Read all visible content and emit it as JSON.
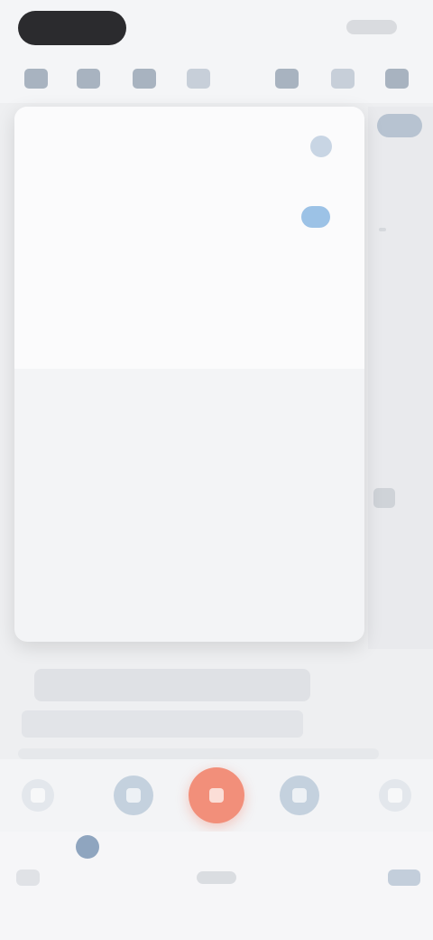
{
  "status_bar": {
    "time": "",
    "indicators": ""
  },
  "toolbar": {
    "tools": [
      {
        "icon": "grid-icon"
      },
      {
        "icon": "bookmark-icon"
      },
      {
        "icon": "tag-icon"
      },
      {
        "icon": "layout-icon"
      },
      {
        "icon": "image-icon"
      },
      {
        "icon": "link-icon"
      },
      {
        "icon": "more-icon"
      }
    ]
  },
  "menu": {
    "title": "",
    "items": [
      {
        "label": "",
        "has_toggle": true
      },
      {
        "label": ""
      },
      {
        "label": ""
      }
    ]
  },
  "content": {
    "section_label": "",
    "chip_text": "",
    "line_text": ""
  },
  "controls": {
    "buttons": [
      {
        "icon": "undo-icon"
      },
      {
        "icon": "format-icon"
      },
      {
        "icon": "record-icon"
      },
      {
        "icon": "attach-icon"
      },
      {
        "icon": "redo-icon"
      }
    ]
  },
  "bottom_bar": {
    "left_label": "",
    "right_label": "",
    "center_label": ""
  },
  "colors": {
    "accent": "#f28f7a",
    "secondary": "#9cc2e6",
    "background": "#eeeff1"
  }
}
